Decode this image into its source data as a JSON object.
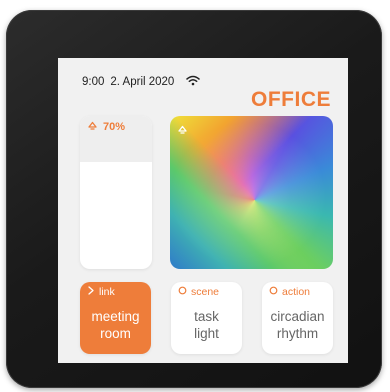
{
  "status": {
    "time": "9:00",
    "date": "2. April 2020",
    "wifi_icon": "wifi-icon"
  },
  "room": {
    "title": "OFFICE"
  },
  "dimmer": {
    "icon": "lamp-icon",
    "label": "70%",
    "level_percent": 70
  },
  "color_picker": {
    "icon": "lamp-icon"
  },
  "tiles": [
    {
      "type": "link",
      "head_label": "link",
      "icon": "chevron-right-icon",
      "line1": "meeting",
      "line2": "room",
      "active": true
    },
    {
      "type": "scene",
      "head_label": "scene",
      "icon": "circle-icon",
      "line1": "task",
      "line2": "light",
      "active": false
    },
    {
      "type": "action",
      "head_label": "action",
      "icon": "circle-icon",
      "line1": "circadian",
      "line2": "rhythm",
      "active": false
    }
  ],
  "colors": {
    "accent": "#ee7d3a",
    "screen_bg": "#f1f1f1",
    "bezel": "#1a1a1a"
  }
}
